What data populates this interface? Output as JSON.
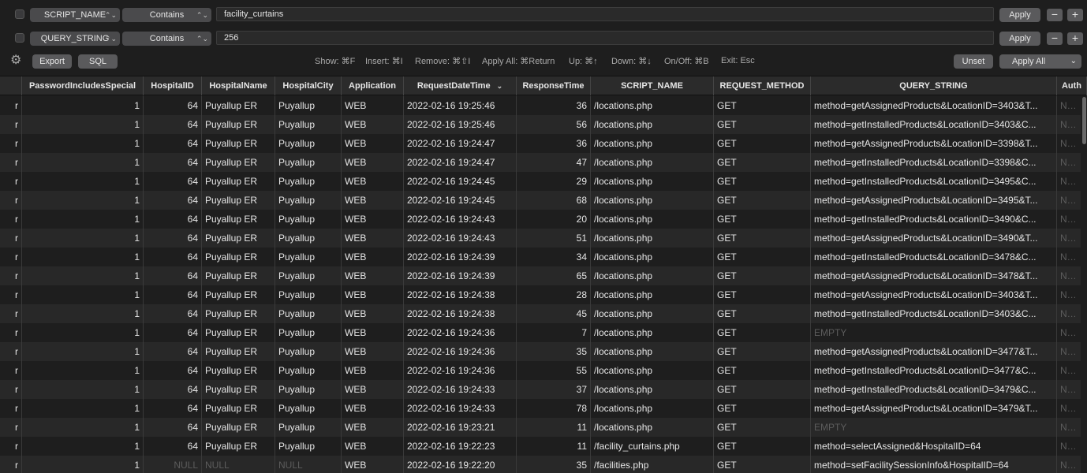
{
  "filters": [
    {
      "field": "SCRIPT_NAME",
      "operator": "Contains",
      "value": "facility_curtains",
      "apply_label": "Apply",
      "minus": "−",
      "plus": "+"
    },
    {
      "field": "QUERY_STRING",
      "operator": "Contains",
      "value": "256",
      "apply_label": "Apply",
      "minus": "−",
      "plus": "+"
    }
  ],
  "toolbar": {
    "export_label": "Export",
    "sql_label": "SQL",
    "hints": [
      "Show: ⌘F",
      "Insert: ⌘I",
      "Remove: ⌘⇧I",
      "Apply All: ⌘Return",
      "Up: ⌘↑",
      "Down: ⌘↓",
      "On/Off: ⌘B",
      "Exit: Esc"
    ],
    "unset_label": "Unset",
    "apply_all_label": "Apply All"
  },
  "table": {
    "columns": [
      "",
      "PasswordIncludesSpecial",
      "HospitalID",
      "HospitalName",
      "HospitalCity",
      "Application",
      "RequestDateTime",
      "ResponseTime",
      "SCRIPT_NAME",
      "REQUEST_METHOD",
      "QUERY_STRING",
      "Auth"
    ],
    "sort_indicator": "⌄",
    "rows": [
      [
        "r",
        "1",
        "64",
        "Puyallup ER",
        "Puyallup",
        "WEB",
        "2022-02-16 19:25:46",
        "36",
        "/locations.php",
        "GET",
        "method=getAssignedProducts&LocationID=3403&T...",
        "NULL"
      ],
      [
        "r",
        "1",
        "64",
        "Puyallup ER",
        "Puyallup",
        "WEB",
        "2022-02-16 19:25:46",
        "56",
        "/locations.php",
        "GET",
        "method=getInstalledProducts&LocationID=3403&C...",
        "NULL"
      ],
      [
        "r",
        "1",
        "64",
        "Puyallup ER",
        "Puyallup",
        "WEB",
        "2022-02-16 19:24:47",
        "36",
        "/locations.php",
        "GET",
        "method=getAssignedProducts&LocationID=3398&T...",
        "NULL"
      ],
      [
        "r",
        "1",
        "64",
        "Puyallup ER",
        "Puyallup",
        "WEB",
        "2022-02-16 19:24:47",
        "47",
        "/locations.php",
        "GET",
        "method=getInstalledProducts&LocationID=3398&C...",
        "NULL"
      ],
      [
        "r",
        "1",
        "64",
        "Puyallup ER",
        "Puyallup",
        "WEB",
        "2022-02-16 19:24:45",
        "29",
        "/locations.php",
        "GET",
        "method=getInstalledProducts&LocationID=3495&C...",
        "NULL"
      ],
      [
        "r",
        "1",
        "64",
        "Puyallup ER",
        "Puyallup",
        "WEB",
        "2022-02-16 19:24:45",
        "68",
        "/locations.php",
        "GET",
        "method=getAssignedProducts&LocationID=3495&T...",
        "NULL"
      ],
      [
        "r",
        "1",
        "64",
        "Puyallup ER",
        "Puyallup",
        "WEB",
        "2022-02-16 19:24:43",
        "20",
        "/locations.php",
        "GET",
        "method=getInstalledProducts&LocationID=3490&C...",
        "NULL"
      ],
      [
        "r",
        "1",
        "64",
        "Puyallup ER",
        "Puyallup",
        "WEB",
        "2022-02-16 19:24:43",
        "51",
        "/locations.php",
        "GET",
        "method=getAssignedProducts&LocationID=3490&T...",
        "NULL"
      ],
      [
        "r",
        "1",
        "64",
        "Puyallup ER",
        "Puyallup",
        "WEB",
        "2022-02-16 19:24:39",
        "34",
        "/locations.php",
        "GET",
        "method=getInstalledProducts&LocationID=3478&C...",
        "NULL"
      ],
      [
        "r",
        "1",
        "64",
        "Puyallup ER",
        "Puyallup",
        "WEB",
        "2022-02-16 19:24:39",
        "65",
        "/locations.php",
        "GET",
        "method=getAssignedProducts&LocationID=3478&T...",
        "NULL"
      ],
      [
        "r",
        "1",
        "64",
        "Puyallup ER",
        "Puyallup",
        "WEB",
        "2022-02-16 19:24:38",
        "28",
        "/locations.php",
        "GET",
        "method=getAssignedProducts&LocationID=3403&T...",
        "NULL"
      ],
      [
        "r",
        "1",
        "64",
        "Puyallup ER",
        "Puyallup",
        "WEB",
        "2022-02-16 19:24:38",
        "45",
        "/locations.php",
        "GET",
        "method=getInstalledProducts&LocationID=3403&C...",
        "NULL"
      ],
      [
        "r",
        "1",
        "64",
        "Puyallup ER",
        "Puyallup",
        "WEB",
        "2022-02-16 19:24:36",
        "7",
        "/locations.php",
        "GET",
        "EMPTY",
        "NULL"
      ],
      [
        "r",
        "1",
        "64",
        "Puyallup ER",
        "Puyallup",
        "WEB",
        "2022-02-16 19:24:36",
        "35",
        "/locations.php",
        "GET",
        "method=getAssignedProducts&LocationID=3477&T...",
        "NULL"
      ],
      [
        "r",
        "1",
        "64",
        "Puyallup ER",
        "Puyallup",
        "WEB",
        "2022-02-16 19:24:36",
        "55",
        "/locations.php",
        "GET",
        "method=getInstalledProducts&LocationID=3477&C...",
        "NULL"
      ],
      [
        "r",
        "1",
        "64",
        "Puyallup ER",
        "Puyallup",
        "WEB",
        "2022-02-16 19:24:33",
        "37",
        "/locations.php",
        "GET",
        "method=getInstalledProducts&LocationID=3479&C...",
        "NULL"
      ],
      [
        "r",
        "1",
        "64",
        "Puyallup ER",
        "Puyallup",
        "WEB",
        "2022-02-16 19:24:33",
        "78",
        "/locations.php",
        "GET",
        "method=getAssignedProducts&LocationID=3479&T...",
        "NULL"
      ],
      [
        "r",
        "1",
        "64",
        "Puyallup ER",
        "Puyallup",
        "WEB",
        "2022-02-16 19:23:21",
        "11",
        "/locations.php",
        "GET",
        "EMPTY",
        "NULL"
      ],
      [
        "r",
        "1",
        "64",
        "Puyallup ER",
        "Puyallup",
        "WEB",
        "2022-02-16 19:22:23",
        "11",
        "/facility_curtains.php",
        "GET",
        "method=selectAssigned&HospitalID=64",
        "NULL"
      ],
      [
        "r",
        "1",
        "NULL",
        "NULL",
        "NULL",
        "WEB",
        "2022-02-16 19:22:20",
        "35",
        "/facilities.php",
        "GET",
        "method=setFacilitySessionInfo&HospitalID=64",
        "NULL"
      ]
    ]
  },
  "colors": {
    "background": "#1e1e1e",
    "row_alt": "#282828",
    "null_text": "#5c5c5c"
  }
}
